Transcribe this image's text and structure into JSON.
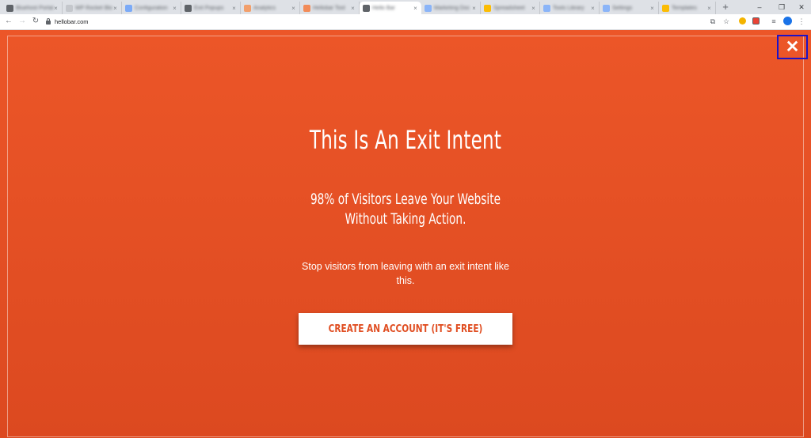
{
  "browser": {
    "tabs": [
      {
        "label": "Bluehost Portal",
        "favicon": "page-icon",
        "favicon_color": "#5f6368"
      },
      {
        "label": "WP Rocket Blog",
        "favicon": "page-icon",
        "favicon_color": "#c4c7cc"
      },
      {
        "label": "Configuration",
        "favicon": "docs-icon",
        "favicon_color": "#7baaf7"
      },
      {
        "label": "Exit Popups",
        "favicon": "page-icon",
        "favicon_color": "#5f6368"
      },
      {
        "label": "Analytics",
        "favicon": "orange-icon",
        "favicon_color": "#f29f6b"
      },
      {
        "label": "Hellobar Tool",
        "favicon": "orange-icon",
        "favicon_color": "#f28b58"
      },
      {
        "label": "Hello Bar",
        "favicon": "page-icon",
        "favicon_color": "#5f6368"
      },
      {
        "label": "Marketing Doc",
        "favicon": "docs-icon",
        "favicon_color": "#8ab4f8"
      },
      {
        "label": "Spreadsheet",
        "favicon": "sheet-icon",
        "favicon_color": "#fbbc04"
      },
      {
        "label": "Tools Library",
        "favicon": "docs-icon",
        "favicon_color": "#8ab4f8"
      },
      {
        "label": "Settings",
        "favicon": "docs-icon",
        "favicon_color": "#8ab4f8"
      },
      {
        "label": "Templates",
        "favicon": "sheet-icon",
        "favicon_color": "#fbbc04"
      }
    ],
    "active_tab_index": 6,
    "new_tab_symbol": "+",
    "window_controls": {
      "minimize": "–",
      "restore": "❐",
      "close": "✕"
    },
    "url": "hellobar.com"
  },
  "popup": {
    "close_symbol": "✕",
    "headline": "This Is An Exit Intent",
    "subheadline_line1": "98% of Visitors Leave Your Website",
    "subheadline_line2": "Without Taking Action.",
    "description_line1": "Stop visitors from leaving with an exit intent like",
    "description_line2": "this.",
    "cta_label": "CREATE AN ACCOUNT (IT'S FREE)"
  },
  "colors": {
    "popup_background": "#e9552a",
    "cta_text": "#e04e22",
    "highlight_box": "#1e12c6"
  }
}
